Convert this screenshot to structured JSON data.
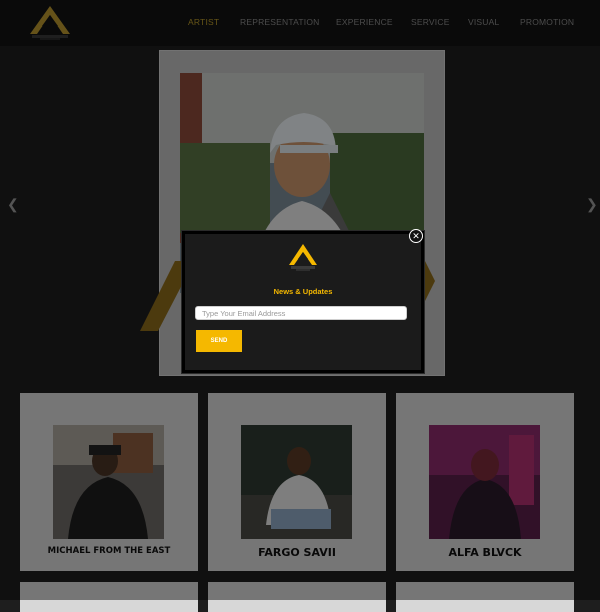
{
  "nav": {
    "items": [
      "ARTIST",
      "REPRESENTATION",
      "EXPERIENCE",
      "SERVICE",
      "VISUAL",
      "PROMOTION"
    ]
  },
  "hero": {
    "prev_icon": "chevron-left-icon",
    "next_icon": "chevron-right-icon"
  },
  "popup": {
    "title": "News & Updates",
    "email_placeholder": "Type Your Email Address",
    "send_label": "SEND",
    "close_icon": "close-icon"
  },
  "artists": [
    {
      "name": "MICHAEL FROM THE EAST"
    },
    {
      "name": "FARGO SAVII"
    },
    {
      "name": "ALFA BLVCK"
    }
  ],
  "colors": {
    "accent": "#f5b800",
    "nav_active": "#b99a2a",
    "background": "#1e1e1e",
    "card": "#d7d7d7"
  }
}
